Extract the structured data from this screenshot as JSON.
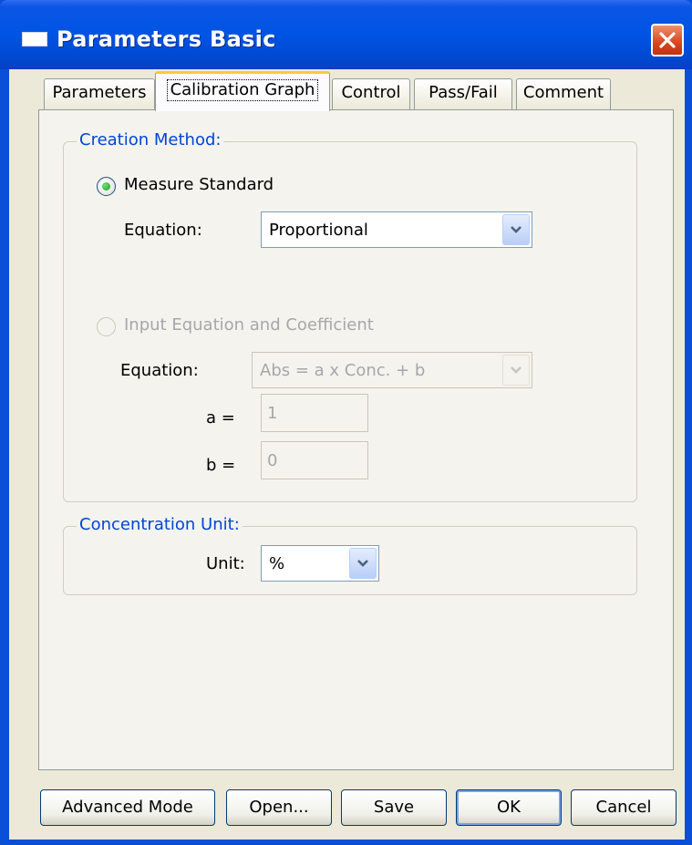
{
  "window": {
    "title": "Parameters  Basic"
  },
  "tabs": [
    {
      "label": "Parameters",
      "active": false
    },
    {
      "label": "Calibration Graph",
      "active": true
    },
    {
      "label": "Control",
      "active": false
    },
    {
      "label": "Pass/Fail",
      "active": false
    },
    {
      "label": "Comment",
      "active": false
    }
  ],
  "creation_method": {
    "group_label": "Creation Method:",
    "measure_standard": {
      "label": "Measure Standard",
      "selected": true,
      "equation_label": "Equation:",
      "equation_value": "Proportional"
    },
    "input_equation": {
      "label": "Input Equation and Coefficient",
      "selected": false,
      "equation_label": "Equation:",
      "equation_value": "Abs = a x Conc. + b",
      "a_label": "a =",
      "a_value": "1",
      "b_label": "b =",
      "b_value": "0"
    }
  },
  "concentration_unit": {
    "group_label": "Concentration Unit:",
    "unit_label": "Unit:",
    "unit_value": "%"
  },
  "buttons": {
    "advanced_mode": "Advanced Mode",
    "open": "Open...",
    "save": "Save",
    "ok": "OK",
    "cancel": "Cancel"
  },
  "colors": {
    "titlebar": "#0054e3",
    "group_label": "#0046d5",
    "disabled_text": "#a7a6aa",
    "dialog_bg": "#ece9d8"
  }
}
